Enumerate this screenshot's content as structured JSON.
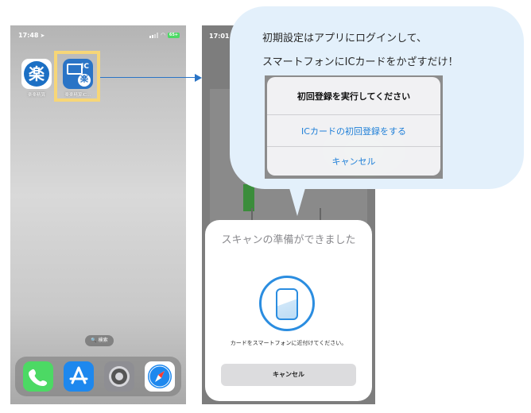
{
  "home_screen": {
    "status_time": "17:48",
    "status_location_glyph": "➤",
    "battery": "65+",
    "apps": [
      {
        "label": "楽楽精算",
        "icon_glyph": "楽"
      },
      {
        "label": "楽楽精算IC…",
        "icon_glyph": "楽",
        "icon_text": "IC"
      }
    ],
    "search_label": "🔍 検索",
    "dock": [
      "phone-icon",
      "app-store-icon",
      "settings-icon",
      "safari-icon"
    ]
  },
  "scan_screen": {
    "status_time": "17:01",
    "sheet_title": "スキャンの準備ができました",
    "sheet_message": "カードをスマートフォンに近付けてください。",
    "cancel_label": "キャンセル"
  },
  "callout": {
    "line1": "初期設定はアプリにログインして、",
    "line2": "スマートフォンにICカードをかざすだけ！",
    "alert": {
      "title": "初回登録を実行してください",
      "primary_action": "ICカードの初回登録をする",
      "cancel_action": "キャンセル"
    }
  },
  "colors": {
    "highlight": "#f7d677",
    "accent_blue": "#2a74c6",
    "bubble": "#e3f0fb",
    "ios_blue": "#1e7fd8"
  }
}
